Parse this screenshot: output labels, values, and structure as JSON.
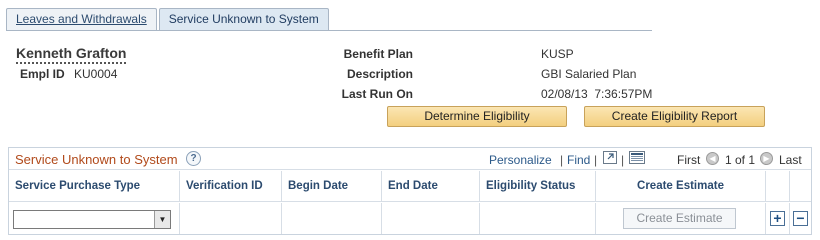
{
  "tabs": [
    {
      "label": "Leaves and Withdrawals",
      "active": false
    },
    {
      "label": "Service Unknown to System",
      "active": true
    }
  ],
  "employee": {
    "name": "Kenneth Grafton",
    "empl_id_label": "Empl ID",
    "empl_id": "KU0004"
  },
  "plan_info": {
    "benefit_plan_label": "Benefit Plan",
    "benefit_plan": "KUSP",
    "description_label": "Description",
    "description": "GBI Salaried Plan",
    "last_run_label": "Last Run On",
    "last_run": "02/08/13  7:36:57PM"
  },
  "buttons": {
    "determine": "Determine Eligibility",
    "create_report": "Create Eligibility Report"
  },
  "grid": {
    "title": "Service Unknown to System",
    "personalize": "Personalize",
    "separator": "|",
    "find": "Find",
    "first": "First",
    "range": "1 of 1",
    "last": "Last",
    "columns": [
      "Service Purchase Type",
      "Verification ID",
      "Begin Date",
      "End Date",
      "Eligibility Status",
      "Create Estimate"
    ],
    "rows": [
      {
        "service_purchase_type": "",
        "verification_id": "",
        "begin_date": "",
        "end_date": "",
        "eligibility_status": "",
        "create_estimate_label": "Create Estimate"
      }
    ]
  }
}
